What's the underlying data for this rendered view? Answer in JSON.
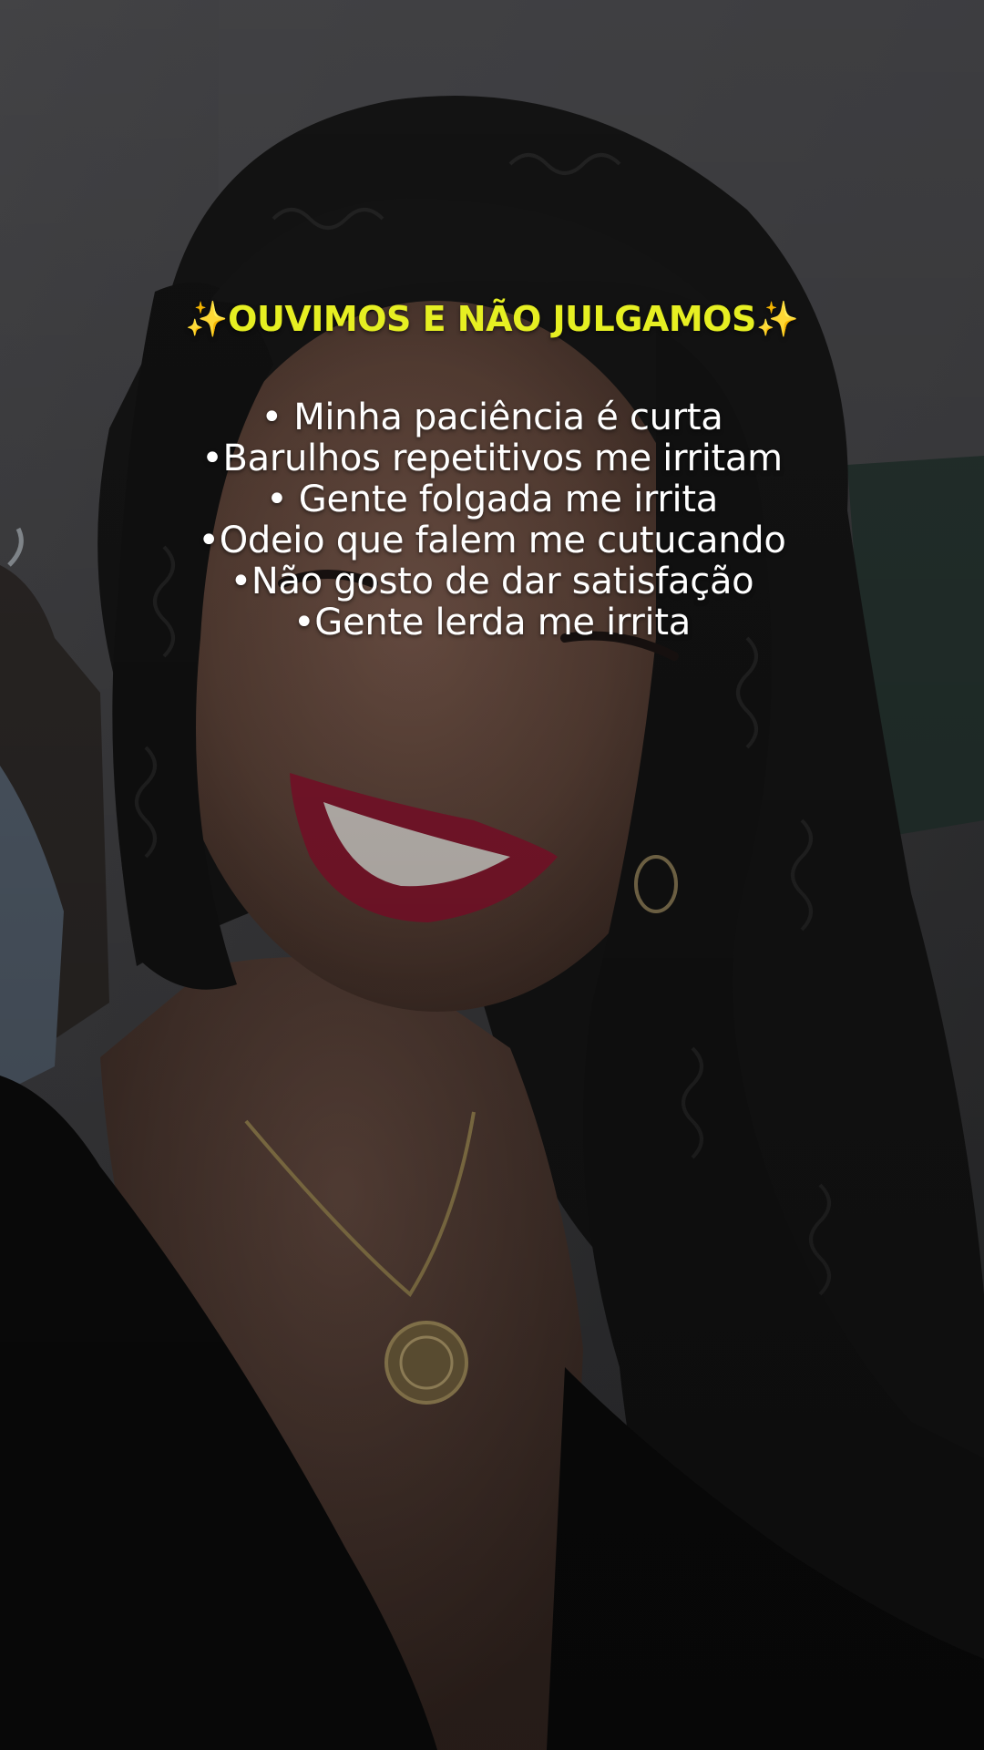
{
  "overlay": {
    "sparkle_left": "✨",
    "headline": "OUVIMOS E NÃO JULGAMOS",
    "sparkle_right": "✨",
    "items": [
      "• Minha paciência é curta",
      "•Barulhos repetitivos me irritam",
      "• Gente folgada me irrita",
      "•Odeio que falem me cutucando",
      "•Não gosto de dar satisfação",
      "•Gente lerda me irrita"
    ]
  },
  "colors": {
    "headline": "#e6ef22",
    "text": "#ffffff",
    "lips": "#8a1830",
    "hair": "#141414",
    "dress": "#0c0c0c"
  }
}
